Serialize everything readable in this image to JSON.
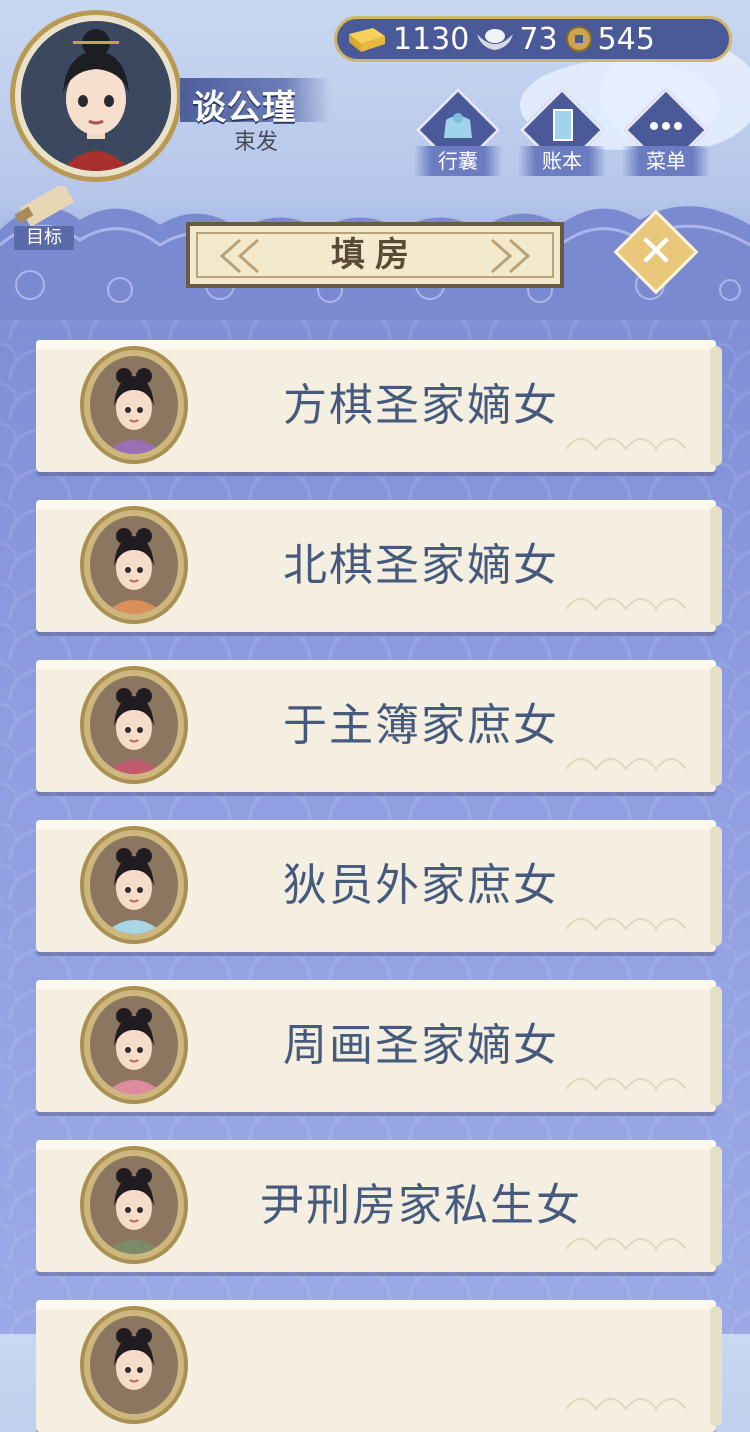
{
  "player": {
    "name": "谈公瑾",
    "subtitle": "束发"
  },
  "currency": [
    {
      "icon": "gold-ingot-icon",
      "value": "1130"
    },
    {
      "icon": "silver-ingot-icon",
      "value": "73"
    },
    {
      "icon": "copper-coin-icon",
      "value": "545"
    }
  ],
  "menu": {
    "bag_label": "行囊",
    "ledger_label": "账本",
    "menu_label": "菜单"
  },
  "goal_label": "目标",
  "panel_title": "填房",
  "close_symbol": "✕",
  "candidates": [
    {
      "label": "方棋圣家嫡女",
      "dress": "#9b6fb8"
    },
    {
      "label": "北棋圣家嫡女",
      "dress": "#d98e5b"
    },
    {
      "label": "于主簿家庶女",
      "dress": "#c25a6e"
    },
    {
      "label": "狄员外家庶女",
      "dress": "#a8d6e4"
    },
    {
      "label": "周画圣家嫡女",
      "dress": "#e08aa0"
    },
    {
      "label": "尹刑房家私生女",
      "dress": "#7d8a6a"
    },
    {
      "label": "",
      "dress": "#8c7660"
    }
  ],
  "colors": {
    "accent": "#4a5a98",
    "gold": "#d2b46a",
    "text": "#455a7c"
  }
}
